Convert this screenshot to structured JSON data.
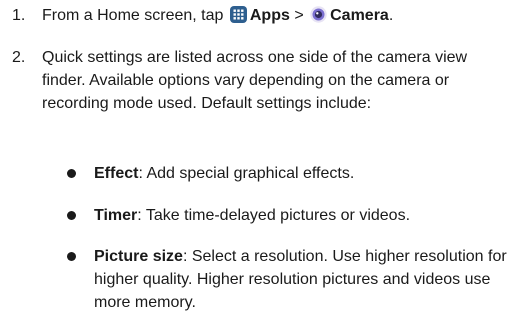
{
  "steps": [
    {
      "number": "1.",
      "text_prefix": "From a Home screen, tap",
      "apps_label": "Apps",
      "separator": ">",
      "camera_label": "Camera",
      "suffix": "."
    },
    {
      "number": "2.",
      "text": "Quick settings are listed across one side of the camera view finder. Available options vary depending on the camera or recording mode used. Default settings include:"
    }
  ],
  "bullets": [
    {
      "term": "Effect",
      "desc": ": Add special graphical effects."
    },
    {
      "term": "Timer",
      "desc": ": Take time-delayed pictures or videos."
    },
    {
      "term": "Picture size",
      "desc": ": Select a resolution. Use higher resolution for higher quality. Higher resolution pictures and videos use more memory."
    }
  ],
  "icons": {
    "apps": "apps-grid-icon",
    "camera": "camera-app-icon"
  },
  "colors": {
    "text": "#1a1a1a",
    "apps_icon_bg": "#2e5f8f",
    "camera_icon_ring": "#7b6fd0"
  }
}
